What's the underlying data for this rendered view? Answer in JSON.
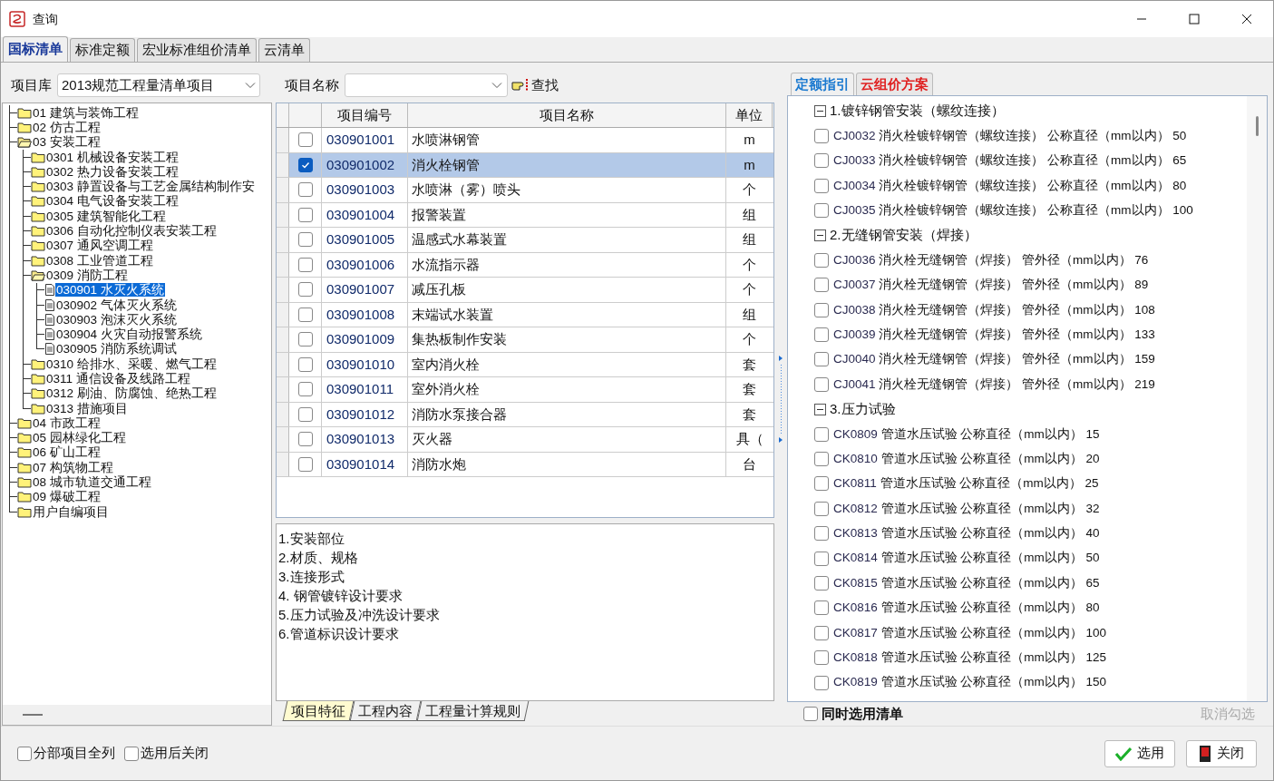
{
  "window": {
    "title": "查询"
  },
  "main_tabs": [
    {
      "label": "国标清单",
      "selected": true
    },
    {
      "label": "标准定额",
      "selected": false
    },
    {
      "label": "宏业标准组价清单",
      "selected": false
    },
    {
      "label": "云清单",
      "selected": false
    }
  ],
  "library": {
    "label": "项目库",
    "value": "2013规范工程量清单项目"
  },
  "tree": [
    {
      "label": "01 建筑与装饰工程",
      "kind": "folder",
      "expanded": false,
      "selected": false
    },
    {
      "label": "02 仿古工程",
      "kind": "folder",
      "expanded": false,
      "selected": false
    },
    {
      "label": "03 安装工程",
      "kind": "folder",
      "expanded": true,
      "selected": false,
      "children": [
        {
          "label": "0301 机械设备安装工程",
          "kind": "folder",
          "expanded": false,
          "selected": false
        },
        {
          "label": "0302 热力设备安装工程",
          "kind": "folder",
          "expanded": false,
          "selected": false
        },
        {
          "label": "0303 静置设备与工艺金属结构制作安",
          "kind": "folder",
          "expanded": false,
          "selected": false
        },
        {
          "label": "0304 电气设备安装工程",
          "kind": "folder",
          "expanded": false,
          "selected": false
        },
        {
          "label": "0305 建筑智能化工程",
          "kind": "folder",
          "expanded": false,
          "selected": false
        },
        {
          "label": "0306 自动化控制仪表安装工程",
          "kind": "folder",
          "expanded": false,
          "selected": false
        },
        {
          "label": "0307 通风空调工程",
          "kind": "folder",
          "expanded": false,
          "selected": false
        },
        {
          "label": "0308 工业管道工程",
          "kind": "folder",
          "expanded": false,
          "selected": false
        },
        {
          "label": "0309 消防工程",
          "kind": "folder",
          "expanded": true,
          "selected": false,
          "children": [
            {
              "label": "030901 水灭火系统",
              "kind": "document",
              "selected": true
            },
            {
              "label": "030902 气体灭火系统",
              "kind": "document",
              "selected": false
            },
            {
              "label": "030903 泡沫灭火系统",
              "kind": "document",
              "selected": false
            },
            {
              "label": "030904 火灾自动报警系统",
              "kind": "document",
              "selected": false
            },
            {
              "label": "030905 消防系统调试",
              "kind": "document",
              "selected": false
            }
          ]
        },
        {
          "label": "0310 给排水、采暖、燃气工程",
          "kind": "folder",
          "expanded": false,
          "selected": false
        },
        {
          "label": "0311 通信设备及线路工程",
          "kind": "folder",
          "expanded": false,
          "selected": false
        },
        {
          "label": "0312 刷油、防腐蚀、绝热工程",
          "kind": "folder",
          "expanded": false,
          "selected": false
        },
        {
          "label": "0313 措施项目",
          "kind": "folder",
          "expanded": false,
          "selected": false
        }
      ]
    },
    {
      "label": "04 市政工程",
      "kind": "folder",
      "expanded": false,
      "selected": false
    },
    {
      "label": "05 园林绿化工程",
      "kind": "folder",
      "expanded": false,
      "selected": false
    },
    {
      "label": "06 矿山工程",
      "kind": "folder",
      "expanded": false,
      "selected": false
    },
    {
      "label": "07 构筑物工程",
      "kind": "folder",
      "expanded": false,
      "selected": false
    },
    {
      "label": "08 城市轨道交通工程",
      "kind": "folder",
      "expanded": false,
      "selected": false
    },
    {
      "label": "09 爆破工程",
      "kind": "folder",
      "expanded": false,
      "selected": false
    },
    {
      "label": "用户自编项目",
      "kind": "folder",
      "expanded": false,
      "selected": false
    }
  ],
  "search": {
    "label": "项目名称",
    "find_button": "查找"
  },
  "table": {
    "columns": [
      "项目编号",
      "项目名称",
      "单位"
    ],
    "rows": [
      {
        "code": "030901001",
        "name": "水喷淋钢管",
        "unit": "m",
        "checked": false,
        "selected": false
      },
      {
        "code": "030901002",
        "name": "消火栓钢管",
        "unit": "m",
        "checked": true,
        "selected": true
      },
      {
        "code": "030901003",
        "name": "水喷淋（雾）喷头",
        "unit": "个",
        "checked": false,
        "selected": false
      },
      {
        "code": "030901004",
        "name": "报警装置",
        "unit": "组",
        "checked": false,
        "selected": false
      },
      {
        "code": "030901005",
        "name": "温感式水幕装置",
        "unit": "组",
        "checked": false,
        "selected": false
      },
      {
        "code": "030901006",
        "name": "水流指示器",
        "unit": "个",
        "checked": false,
        "selected": false
      },
      {
        "code": "030901007",
        "name": "减压孔板",
        "unit": "个",
        "checked": false,
        "selected": false
      },
      {
        "code": "030901008",
        "name": "末端试水装置",
        "unit": "组",
        "checked": false,
        "selected": false
      },
      {
        "code": "030901009",
        "name": "集热板制作安装",
        "unit": "个",
        "checked": false,
        "selected": false
      },
      {
        "code": "030901010",
        "name": "室内消火栓",
        "unit": "套",
        "checked": false,
        "selected": false
      },
      {
        "code": "030901011",
        "name": "室外消火栓",
        "unit": "套",
        "checked": false,
        "selected": false
      },
      {
        "code": "030901012",
        "name": "消防水泵接合器",
        "unit": "套",
        "checked": false,
        "selected": false
      },
      {
        "code": "030901013",
        "name": "灭火器",
        "unit": "具（",
        "checked": false,
        "selected": false
      },
      {
        "code": "030901014",
        "name": "消防水炮",
        "unit": "台",
        "checked": false,
        "selected": false
      }
    ]
  },
  "features": [
    "1.安装部位",
    "2.材质、规格",
    "3.连接形式",
    "4. 钢管镀锌设计要求",
    "5.压力试验及冲洗设计要求",
    "6.管道标识设计要求"
  ],
  "detail_tabs": [
    {
      "label": "项目特征",
      "selected": true
    },
    {
      "label": "工程内容",
      "selected": false
    },
    {
      "label": "工程量计算规则",
      "selected": false
    }
  ],
  "right_tabs": [
    {
      "label": "定额指引",
      "selected": true
    },
    {
      "label": "云组价方案",
      "selected": false
    }
  ],
  "quota_groups": [
    {
      "title": "1.镀锌钢管安装（螺纹连接）",
      "expanded": true,
      "items": [
        {
          "code": "CJ0032",
          "text": "消火栓镀锌钢管（螺纹连接） 公称直径（mm以内） 50",
          "checked": false
        },
        {
          "code": "CJ0033",
          "text": "消火栓镀锌钢管（螺纹连接） 公称直径（mm以内） 65",
          "checked": false
        },
        {
          "code": "CJ0034",
          "text": "消火栓镀锌钢管（螺纹连接） 公称直径（mm以内） 80",
          "checked": false
        },
        {
          "code": "CJ0035",
          "text": "消火栓镀锌钢管（螺纹连接） 公称直径（mm以内） 100",
          "checked": false
        }
      ]
    },
    {
      "title": "2.无缝钢管安装（焊接）",
      "expanded": true,
      "items": [
        {
          "code": "CJ0036",
          "text": "消火栓无缝钢管（焊接） 管外径（mm以内） 76",
          "checked": false
        },
        {
          "code": "CJ0037",
          "text": "消火栓无缝钢管（焊接） 管外径（mm以内） 89",
          "checked": false
        },
        {
          "code": "CJ0038",
          "text": "消火栓无缝钢管（焊接） 管外径（mm以内） 108",
          "checked": false
        },
        {
          "code": "CJ0039",
          "text": "消火栓无缝钢管（焊接） 管外径（mm以内） 133",
          "checked": false
        },
        {
          "code": "CJ0040",
          "text": "消火栓无缝钢管（焊接） 管外径（mm以内） 159",
          "checked": false
        },
        {
          "code": "CJ0041",
          "text": "消火栓无缝钢管（焊接） 管外径（mm以内） 219",
          "checked": false
        }
      ]
    },
    {
      "title": "3.压力试验",
      "expanded": true,
      "items": [
        {
          "code": "CK0809",
          "text": "管道水压试验 公称直径（mm以内） 15",
          "checked": false
        },
        {
          "code": "CK0810",
          "text": "管道水压试验 公称直径（mm以内） 20",
          "checked": false
        },
        {
          "code": "CK0811",
          "text": "管道水压试验 公称直径（mm以内） 25",
          "checked": false
        },
        {
          "code": "CK0812",
          "text": "管道水压试验 公称直径（mm以内） 32",
          "checked": false
        },
        {
          "code": "CK0813",
          "text": "管道水压试验 公称直径（mm以内） 40",
          "checked": false
        },
        {
          "code": "CK0814",
          "text": "管道水压试验 公称直径（mm以内） 50",
          "checked": false
        },
        {
          "code": "CK0815",
          "text": "管道水压试验 公称直径（mm以内） 65",
          "checked": false
        },
        {
          "code": "CK0816",
          "text": "管道水压试验 公称直径（mm以内） 80",
          "checked": false
        },
        {
          "code": "CK0817",
          "text": "管道水压试验 公称直径（mm以内） 100",
          "checked": false
        },
        {
          "code": "CK0818",
          "text": "管道水压试验 公称直径（mm以内） 125",
          "checked": false
        },
        {
          "code": "CK0819",
          "text": "管道水压试验 公称直径（mm以内） 150",
          "checked": false
        }
      ]
    }
  ],
  "also_select_list": {
    "label": "同时选用清单",
    "checked": false
  },
  "uncheck_link": {
    "label": "取消勾选",
    "disabled": true
  },
  "options": [
    {
      "label": "分部项目全列",
      "checked": false
    },
    {
      "label": "选用后关闭",
      "checked": false
    }
  ],
  "buttons": [
    {
      "label": "选用",
      "kind": "confirm"
    },
    {
      "label": "关闭",
      "kind": "close"
    }
  ]
}
